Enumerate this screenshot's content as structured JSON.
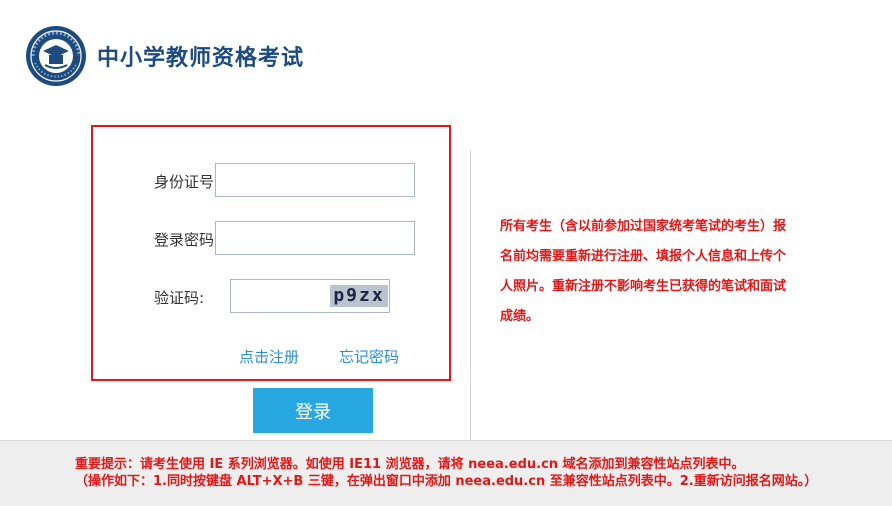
{
  "header": {
    "site_title": "中小学教师资格考试"
  },
  "login": {
    "id_label": "身份证号:",
    "id_value": "",
    "password_label": "登录密码:",
    "password_value": "",
    "captcha_label": "验证码:",
    "captcha_value": "",
    "captcha_image_text": "p9zx",
    "register_link": "点击注册",
    "forgot_link": "忘记密码",
    "login_button": "登录"
  },
  "notice": {
    "text": "所有考生（含以前参加过国家统考笔试的考生）报名前均需要重新进行注册、填报个人信息和上传个人照片。重新注册不影响考生已获得的笔试和面试成绩。"
  },
  "footer": {
    "line1": "重要提示：请考生使用 IE 系列浏览器。如使用 IE11 浏览器，请将 neea.edu.cn 域名添加到兼容性站点列表中。",
    "line2": "（操作如下：1.同时按键盘 ALT+X+B 三键，在弹出窗口中添加 neea.edu.cn 至兼容性站点列表中。2.重新访问报名网站。）"
  },
  "colors": {
    "brand_blue": "#1d4b80",
    "accent_red": "#e01818",
    "button_blue": "#27a8e0",
    "link_blue": "#2a8fd0"
  },
  "icons": {
    "logo": "teacher-qualification-exam-logo"
  }
}
